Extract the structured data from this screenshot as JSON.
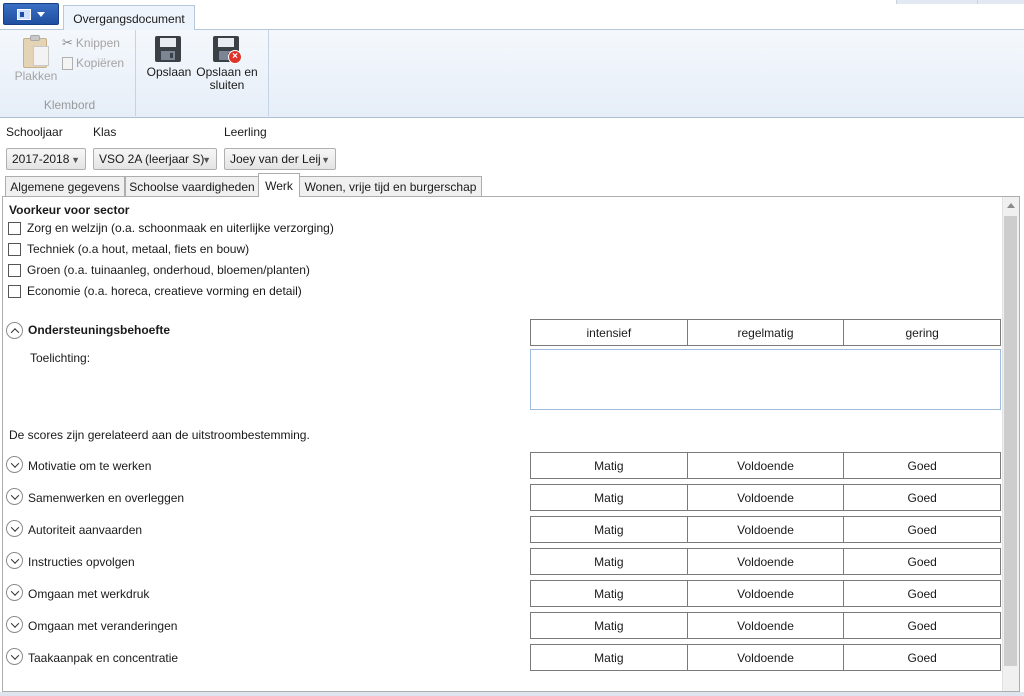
{
  "window": {
    "tab_title": "Overgangsdocument"
  },
  "ribbon": {
    "clipboard": {
      "paste_label": "Plakken",
      "cut_label": "Knippen",
      "copy_label": "Kopiëren",
      "group_label": "Klembord"
    },
    "save": {
      "save_label": "Opslaan",
      "save_close_label_line1": "Opslaan en",
      "save_close_label_line2": "sluiten"
    }
  },
  "selectors": {
    "schooljaar": {
      "label": "Schooljaar",
      "value": "2017-2018"
    },
    "klas": {
      "label": "Klas",
      "value": "VSO 2A (leerjaar S)"
    },
    "leerling": {
      "label": "Leerling",
      "value": "Joey van der Leij"
    }
  },
  "tabs": [
    {
      "label": "Algemene gegevens"
    },
    {
      "label": "Schoolse vaardigheden"
    },
    {
      "label": "Werk"
    },
    {
      "label": "Wonen, vrije tijd en burgerschap"
    }
  ],
  "active_tab": "Werk",
  "sector": {
    "title": "Voorkeur voor sector",
    "options": [
      {
        "label": "Zorg en welzijn (o.a. schoonmaak en uiterlijke verzorging)",
        "checked": false
      },
      {
        "label": "Techniek (o.a hout, metaal, fiets en bouw)",
        "checked": false
      },
      {
        "label": "Groen (o.a. tuinaanleg, onderhoud, bloemen/planten)",
        "checked": false
      },
      {
        "label": "Economie (o.a. horeca, creatieve vorming en detail)",
        "checked": false
      }
    ]
  },
  "support": {
    "title": "Ondersteuningsbehoefte",
    "levels": [
      "intensief",
      "regelmatig",
      "gering"
    ],
    "toelichting_label": "Toelichting:",
    "toelichting_value": ""
  },
  "scores": {
    "note": "De scores zijn gerelateerd aan de uitstroombestemming.",
    "levels": [
      "Matig",
      "Voldoende",
      "Goed"
    ],
    "items": [
      {
        "label": "Motivatie om te werken"
      },
      {
        "label": "Samenwerken en overleggen"
      },
      {
        "label": "Autoriteit aanvaarden"
      },
      {
        "label": "Instructies opvolgen"
      },
      {
        "label": "Omgaan met werkdruk"
      },
      {
        "label": "Omgaan met veranderingen"
      },
      {
        "label": "Taakaanpak en concentratie"
      }
    ]
  }
}
